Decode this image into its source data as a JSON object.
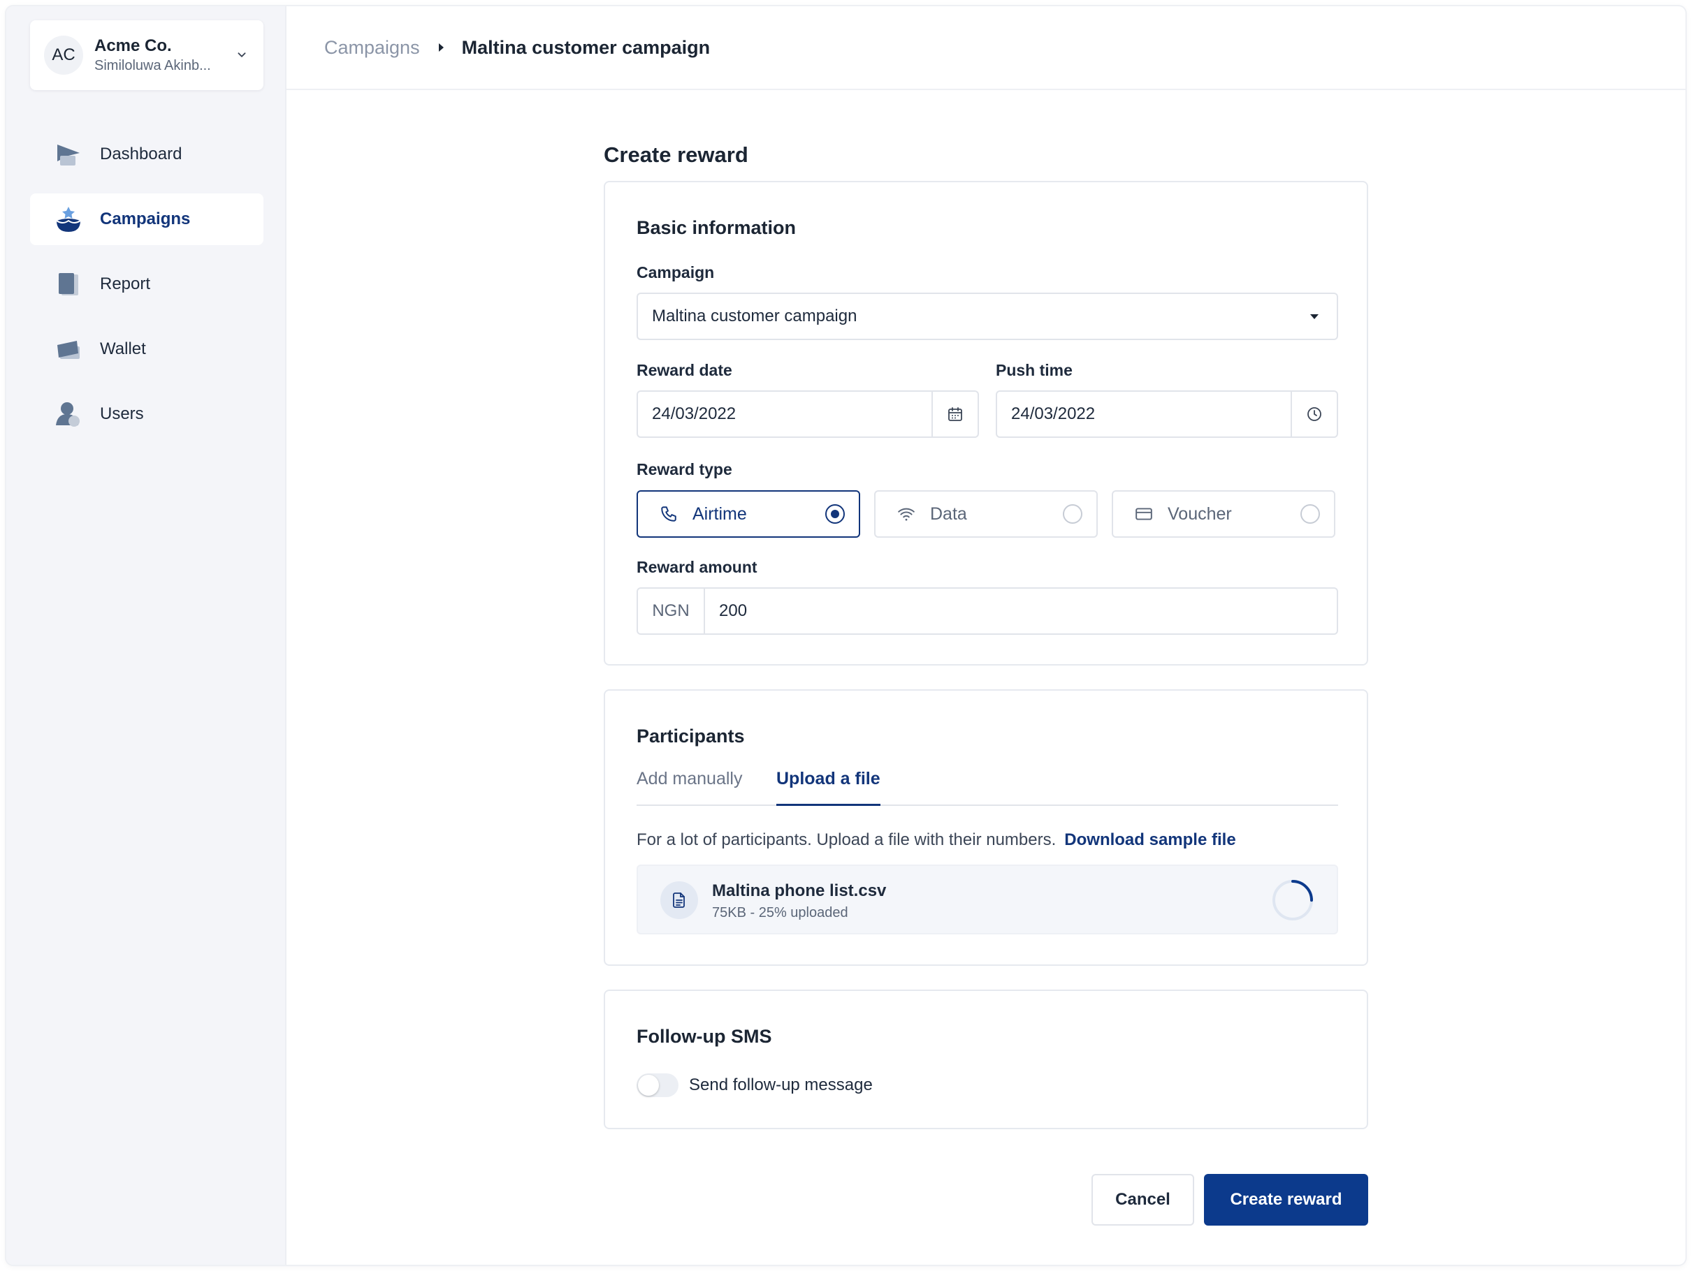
{
  "org": {
    "initials": "AC",
    "name": "Acme Co.",
    "user": "Similoluwa Akinb..."
  },
  "nav": {
    "items": [
      {
        "label": "Dashboard",
        "icon": "dashboard-icon"
      },
      {
        "label": "Campaigns",
        "icon": "campaigns-icon",
        "active": true
      },
      {
        "label": "Report",
        "icon": "report-icon"
      },
      {
        "label": "Wallet",
        "icon": "wallet-icon"
      },
      {
        "label": "Users",
        "icon": "users-icon"
      }
    ]
  },
  "breadcrumb": {
    "parent": "Campaigns",
    "current": "Maltina customer campaign"
  },
  "page": {
    "title": "Create reward"
  },
  "basic_info": {
    "title": "Basic information",
    "campaign_label": "Campaign",
    "campaign_value": "Maltina customer campaign",
    "reward_date_label": "Reward date",
    "reward_date_value": "24/03/2022",
    "push_time_label": "Push time",
    "push_time_value": "24/03/2022",
    "reward_type_label": "Reward type",
    "reward_types": [
      {
        "label": "Airtime",
        "icon": "phone-icon",
        "selected": true
      },
      {
        "label": "Data",
        "icon": "wifi-icon",
        "selected": false
      },
      {
        "label": "Voucher",
        "icon": "card-icon",
        "selected": false
      }
    ],
    "reward_amount_label": "Reward amount",
    "currency": "NGN",
    "amount": "200"
  },
  "participants": {
    "title": "Participants",
    "tabs": [
      "Add manually",
      "Upload a file"
    ],
    "active_tab": "Upload a file",
    "help_text": "For a lot of participants. Upload a file with their numbers.",
    "download_link": "Download sample file",
    "file": {
      "name": "Maltina phone list.csv",
      "meta": "75KB - 25% uploaded",
      "progress": 0.25
    }
  },
  "followup": {
    "title": "Follow-up SMS",
    "toggle_label": "Send follow-up message",
    "enabled": false
  },
  "actions": {
    "cancel": "Cancel",
    "submit": "Create reward"
  },
  "colors": {
    "primary": "#0c3a8c",
    "accent_text": "#12357a",
    "sidebar_bg": "#f4f5f9"
  }
}
